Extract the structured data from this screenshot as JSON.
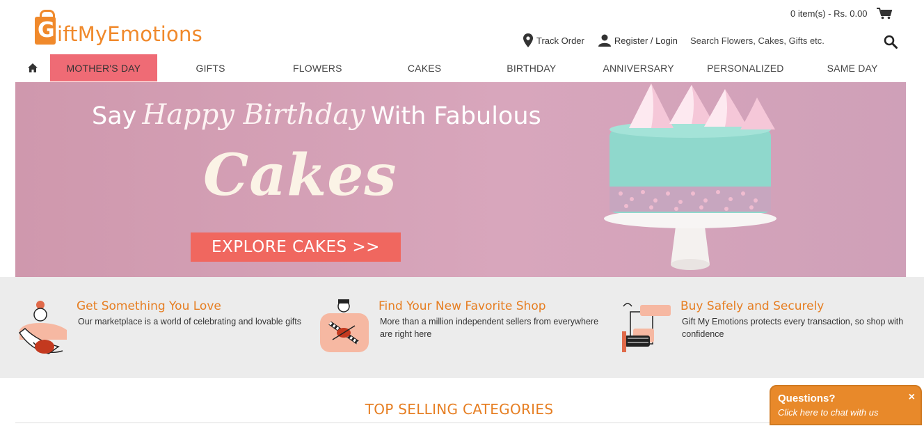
{
  "brand": {
    "logo_letter": "G",
    "logo_text": "iftMyEmotions"
  },
  "cart": {
    "summary": "0 item(s) - Rs. 0.00",
    "icon": "cart-icon"
  },
  "topnav": {
    "track_order": "Track Order",
    "register_login": "Register / Login"
  },
  "search": {
    "placeholder": "Search Flowers, Cakes, Gifts etc.",
    "icon": "search-icon"
  },
  "mainnav": {
    "home_icon": "home-icon",
    "items": [
      {
        "label": "Mother's Day",
        "active": true
      },
      {
        "label": "Gifts"
      },
      {
        "label": "Flowers"
      },
      {
        "label": "Cakes"
      },
      {
        "label": "Birthday"
      },
      {
        "label": "Anniversary"
      },
      {
        "label": "Personalized"
      },
      {
        "label": "Same Day"
      }
    ]
  },
  "banner": {
    "line1_start": "Say",
    "line1_script": "Happy Birthday",
    "line1_end": "With Fabulous",
    "headline": "Cakes",
    "cta": "EXPLORE CAKES >>"
  },
  "features": [
    {
      "title": "Get Something You Love",
      "description": "Our marketplace is a world of celebrating and lovable gifts",
      "icon": "gift-love-illustration"
    },
    {
      "title": "Find Your New Favorite Shop",
      "description": "More than a million independent sellers from everywhere are right here",
      "icon": "shop-illustration"
    },
    {
      "title": "Buy Safely and Securely",
      "description": "Gift My Emotions protects every transaction, so shop with confidence",
      "icon": "secure-illustration"
    }
  ],
  "section": {
    "title": "TOP SELLING CATEGORIES"
  },
  "chat": {
    "title": "Questions?",
    "subtitle": "Click here to chat with us",
    "close": "×"
  },
  "colors": {
    "brand_orange": "#f0892b",
    "active_nav": "#ef6b75",
    "cta": "#f0675f",
    "banner_bg": "#d4a0b6",
    "feature_title": "#e67e22"
  }
}
